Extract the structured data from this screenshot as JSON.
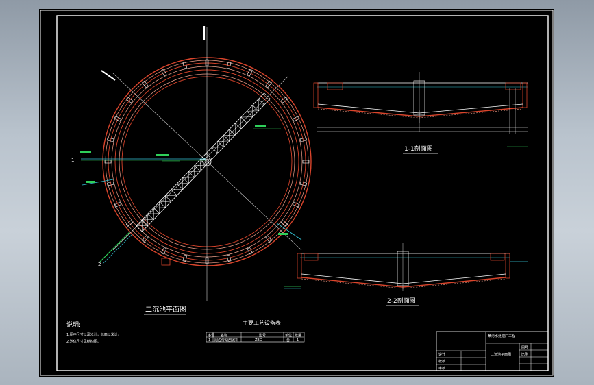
{
  "drawing": {
    "plan_title": "二沉池平面图",
    "section1_title": "1-1剖面图",
    "section2_title": "2-2剖面图",
    "notes_title": "说明:",
    "notes": [
      "1.图中尺寸以毫米计，标高以米计。",
      "2.池体尺寸见结构图。"
    ],
    "equipment_table_title": "主要工艺设备表",
    "equipment_table_headers": [
      "序号",
      "名称",
      "型号",
      "单位",
      "数量"
    ],
    "equipment_table_rows": [
      [
        "1",
        "周边传动刮泥机",
        "ZBG-",
        "台",
        "1"
      ]
    ],
    "section_marks": [
      "1",
      "1",
      "2",
      "2"
    ],
    "title_block": {
      "project": "某污水处理厂工程",
      "drawing_name": "二沉池平面图",
      "fields": [
        "设计",
        "校核",
        "审核",
        "图号",
        "比例"
      ]
    }
  },
  "colors": {
    "canvas": "#000000",
    "frame": "#ffffff",
    "ring_red": "#d9442b",
    "ring_salmon": "#f0a08c",
    "structure": "#ffffff",
    "pipe_green": "#2fd05a",
    "pipe_cyan": "#35c7d9"
  }
}
